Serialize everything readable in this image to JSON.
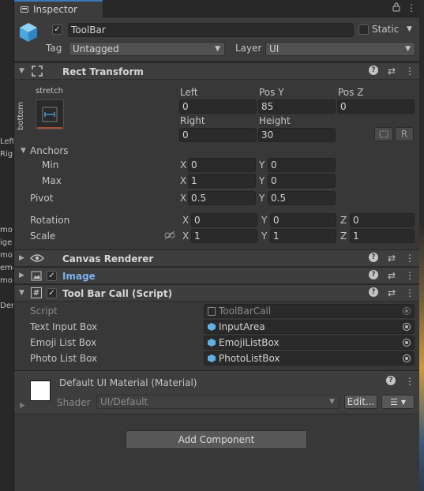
{
  "left_strip": {
    "fragments": [
      "Left",
      "Righ",
      "mo",
      "ige",
      "mo",
      "eme",
      "mo",
      "Dem"
    ]
  },
  "tab": {
    "label": "Inspector"
  },
  "gameobject": {
    "active": true,
    "name": "ToolBar",
    "static_label": "Static",
    "tag_label": "Tag",
    "tag_value": "Untagged",
    "layer_label": "Layer",
    "layer_value": "UI"
  },
  "rect_transform": {
    "title": "Rect Transform",
    "anchor_preset_top": "stretch",
    "anchor_preset_side": "bottom",
    "cols": [
      "Left",
      "Pos Y",
      "Pos Z"
    ],
    "row1": [
      "0",
      "85",
      "0"
    ],
    "cols2": [
      "Right",
      "Height"
    ],
    "row2": [
      "0",
      "30"
    ],
    "r_button": "R",
    "anchors_label": "Anchors",
    "min_label": "Min",
    "min_x": "0",
    "min_y": "0",
    "max_label": "Max",
    "max_x": "1",
    "max_y": "0",
    "pivot_label": "Pivot",
    "pivot_x": "0.5",
    "pivot_y": "0.5",
    "rotation_label": "Rotation",
    "rotation": [
      "0",
      "0",
      "0"
    ],
    "scale_label": "Scale",
    "scale": [
      "1",
      "1",
      "1"
    ],
    "axis_x": "X",
    "axis_y": "Y",
    "axis_z": "Z"
  },
  "canvas_renderer": {
    "title": "Canvas Renderer"
  },
  "image": {
    "title": "Image",
    "enabled": true
  },
  "script": {
    "title": "Tool Bar Call (Script)",
    "enabled": true,
    "fields": [
      {
        "label": "Script",
        "value": "ToolBarCall"
      },
      {
        "label": "Text Input Box",
        "value": "InputArea"
      },
      {
        "label": "Emoji List Box",
        "value": "EmojiListBox"
      },
      {
        "label": "Photo List Box",
        "value": "PhotoListBox"
      }
    ]
  },
  "material": {
    "title": "Default UI Material (Material)",
    "shader_label": "Shader",
    "shader_value": "UI/Default",
    "edit_button": "Edit..."
  },
  "add_component": "Add Component",
  "colors": {
    "accent": "#3a79bb",
    "panel": "#383838",
    "field": "#2a2a2a",
    "link": "#7bb4f0"
  },
  "check_mark": "✓"
}
